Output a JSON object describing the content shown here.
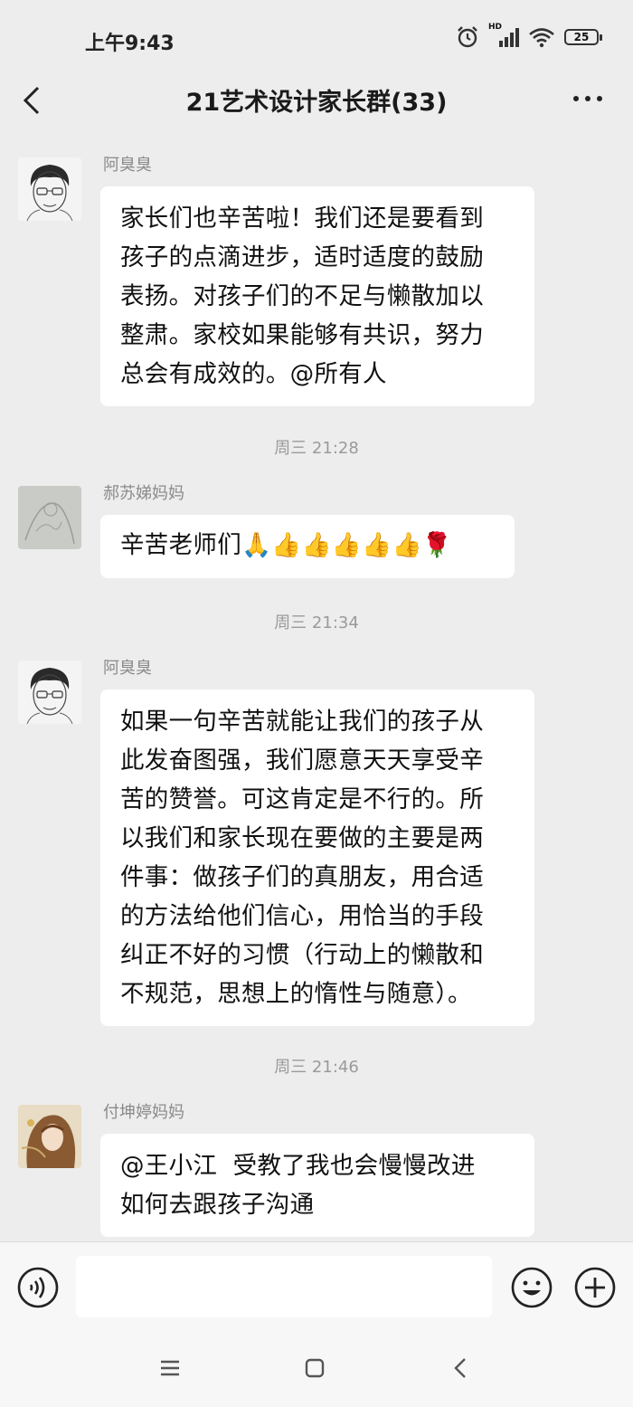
{
  "status": {
    "time": "上午9:43",
    "hd": "HD",
    "battery": "25"
  },
  "header": {
    "title": "21艺术设计家长群(33)"
  },
  "messages": [
    {
      "sender": "阿臭臭",
      "lines": [
        "家长们也辛苦啦！我们还是要看到",
        "孩子的点滴进步，适时适度的鼓励",
        "表扬。对孩子们的不足与懒散加以",
        "整肃。家校如果能够有共识，努力",
        "总会有成效的。@所有人"
      ]
    },
    {
      "timestamp": "周三 21:28"
    },
    {
      "sender": "郝苏娣妈妈",
      "text": "辛苦老师们",
      "emojis": [
        "🙏",
        "👍",
        "👍",
        "👍",
        "👍",
        "👍",
        "🌹"
      ]
    },
    {
      "timestamp": "周三 21:34"
    },
    {
      "sender": "阿臭臭",
      "lines": [
        "如果一句辛苦就能让我们的孩子从",
        "此发奋图强，我们愿意天天享受辛",
        "苦的赞誉。可这肯定是不行的。所",
        "以我们和家长现在要做的主要是两",
        "件事：做孩子们的真朋友，用合适",
        "的方法给他们信心，用恰当的手段",
        "纠正不好的习惯（行动上的懒散和",
        "不规范，思想上的惰性与随意）。"
      ]
    },
    {
      "timestamp": "周三 21:46"
    },
    {
      "sender": "付坤婷妈妈",
      "lines": [
        "@王小江  受教了我也会慢慢改进",
        "如何去跟孩子沟通"
      ]
    }
  ],
  "icons": {
    "back": "chevron-left-icon",
    "more": "more-dots-icon",
    "voice": "voice-icon",
    "emoji": "emoji-icon",
    "plus": "plus-icon",
    "menu": "menu-icon",
    "home": "home-square-icon",
    "sys_back": "sys-back-icon"
  },
  "colors": {
    "background": "#ededed",
    "bubble": "#ffffff",
    "sender": "#8a8a8a",
    "timestamp": "#9a9a9a"
  }
}
